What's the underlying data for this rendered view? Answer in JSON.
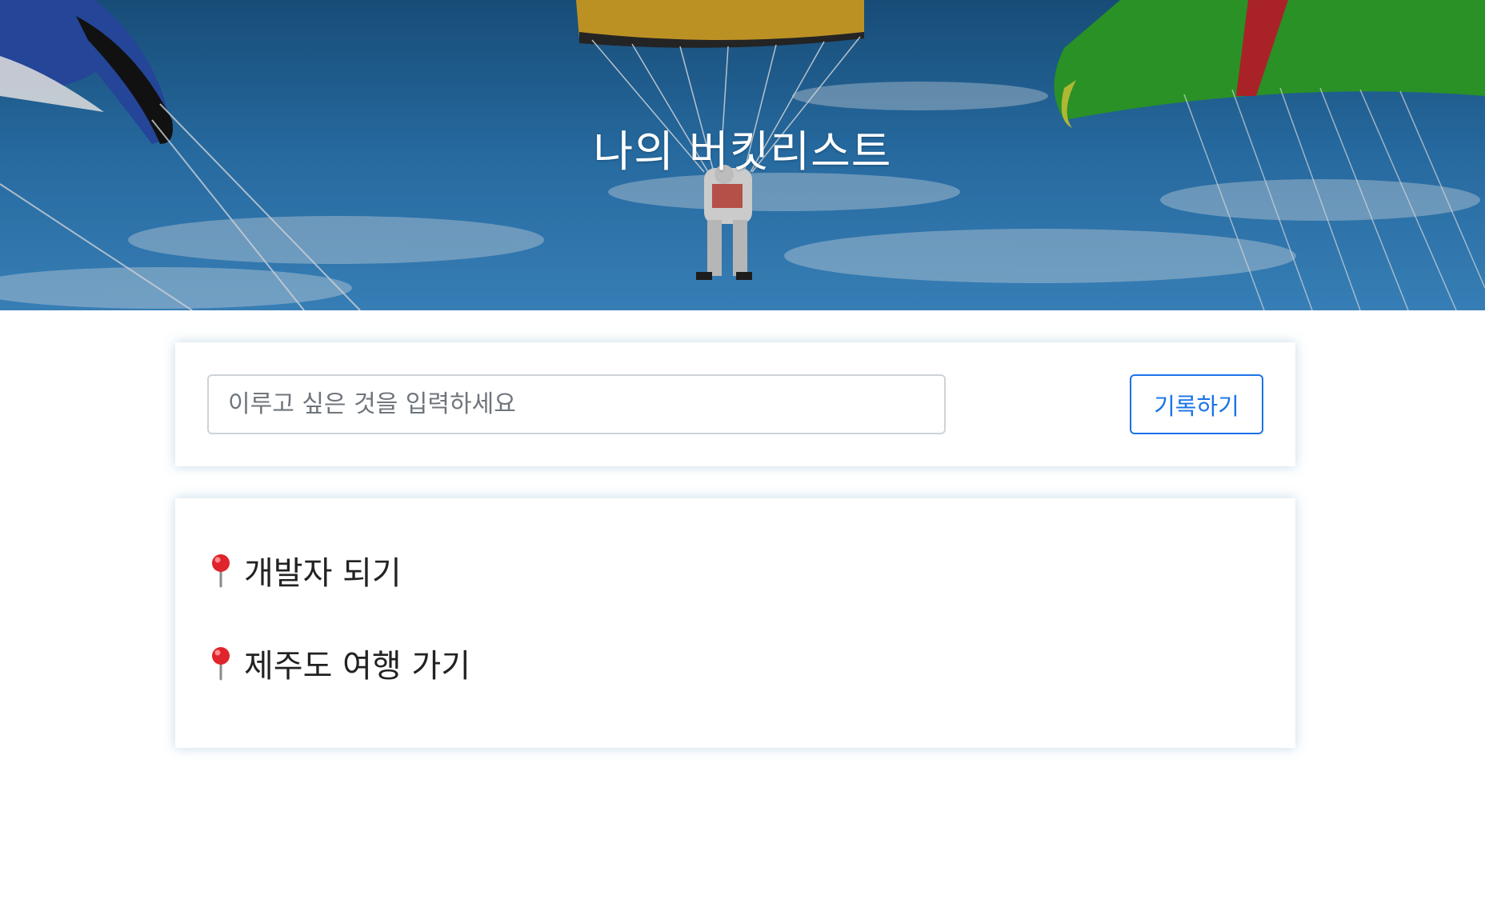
{
  "header": {
    "title": "나의 버킷리스트",
    "background_image": "parachutes-sky"
  },
  "form": {
    "input_placeholder": "이루고 싶은 것을 입력하세요",
    "input_value": "",
    "submit_label": "기록하기"
  },
  "bucket_list": {
    "items": [
      {
        "icon": "round-pushpin-icon",
        "text": "개발자 되기"
      },
      {
        "icon": "round-pushpin-icon",
        "text": "제주도 여행 가기"
      }
    ]
  },
  "colors": {
    "accent": "#1a73e8",
    "pin": "#e0242b",
    "text": "#222222",
    "sky": "#2a78b4"
  }
}
